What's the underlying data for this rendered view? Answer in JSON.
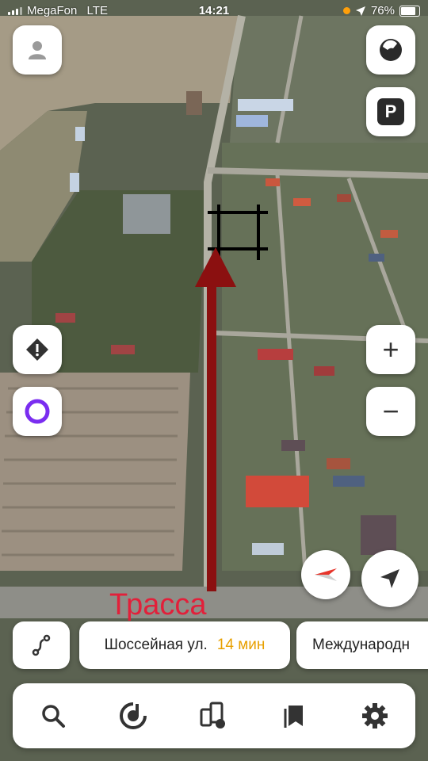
{
  "status_bar": {
    "carrier": "MegaFon",
    "network": "LTE",
    "time": "14:21",
    "battery": "76%"
  },
  "overlay": {
    "road_label": "Трасса"
  },
  "parking": {
    "label": "P"
  },
  "zoom": {
    "in_label": "+",
    "out_label": "−"
  },
  "route_suggestions": [
    {
      "destination": "Шоссейная ул.",
      "eta": "14 мин"
    },
    {
      "destination": "Международн",
      "eta": ""
    }
  ],
  "toolbar": {
    "items": [
      "search-icon",
      "music-icon",
      "transport-icon",
      "bookmarks-icon",
      "settings-icon"
    ]
  },
  "colors": {
    "arrow": "#8b1010",
    "overlay_text": "#e2203a",
    "eta": "#e8a000",
    "alice": "#7a2df0"
  }
}
